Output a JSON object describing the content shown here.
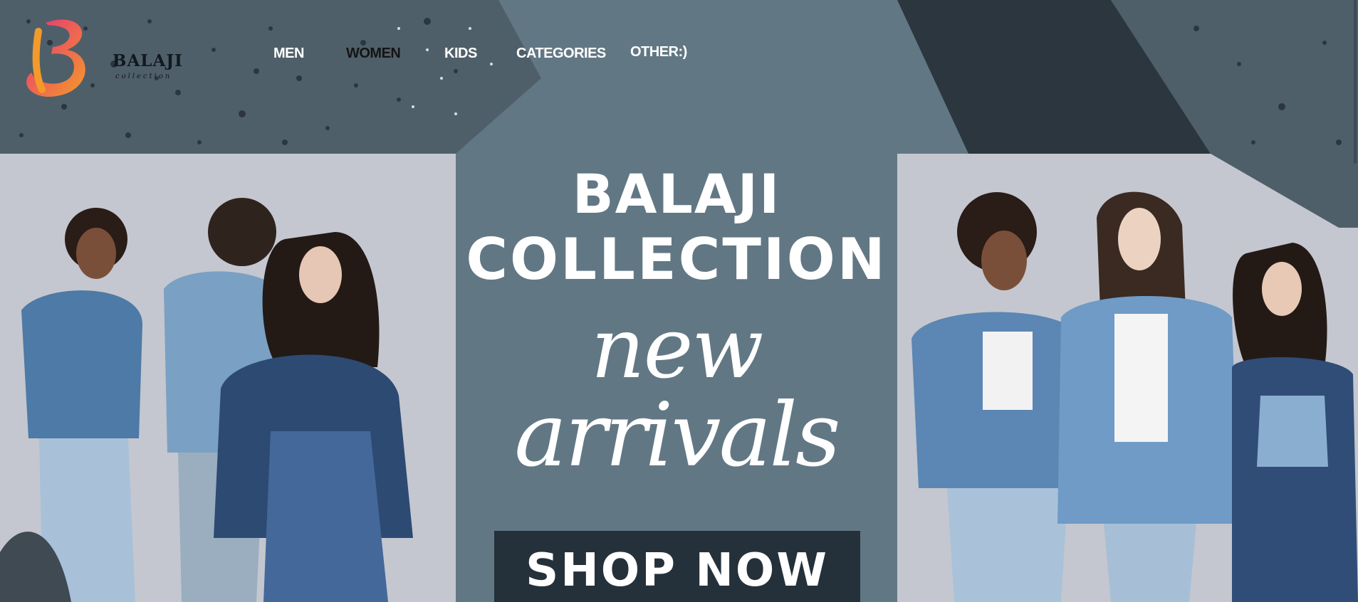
{
  "brand": {
    "name": "BALAJI",
    "tagline": "collection"
  },
  "nav": {
    "items": [
      {
        "label": "MEN",
        "tone": "light"
      },
      {
        "label": "WOMEN",
        "tone": "dark"
      },
      {
        "label": "KIDS",
        "tone": "light"
      },
      {
        "label": "CATEGORIES",
        "tone": "light"
      },
      {
        "label": "OTHER:)",
        "tone": "light"
      }
    ]
  },
  "hero": {
    "title_line1": "BALAJI",
    "title_line2": "COLLECTION",
    "script_line1": "new",
    "script_line2": "arrivals",
    "cta_label": "SHOP NOW"
  },
  "colors": {
    "background": "#627784",
    "texture_dark": "#2b363f",
    "cta_background": "#25313a",
    "photo_backdrop": "#c3c6ce",
    "logo_orange": "#f39a2a",
    "logo_pink": "#e8307a"
  },
  "images": {
    "left": "group of models in denim jackets",
    "right": "three models in denim outfits"
  }
}
